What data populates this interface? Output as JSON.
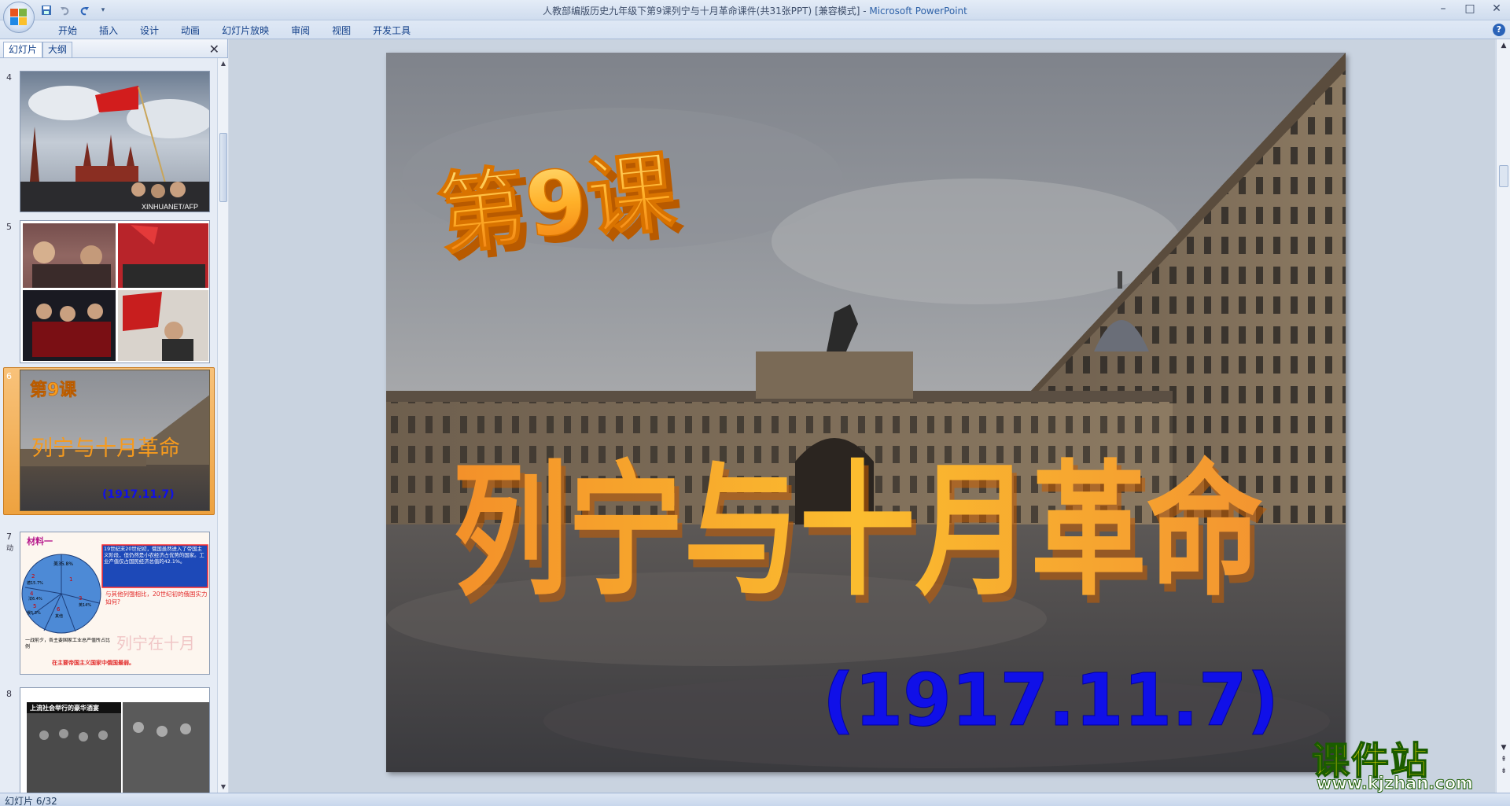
{
  "window": {
    "title_doc": "人教部编版历史九年级下第9课列宁与十月革命课件(共31张PPT) [兼容模式]",
    "title_sep": " - ",
    "title_app": "Microsoft PowerPoint",
    "minimize": "–",
    "maximize": "□",
    "close": "✕"
  },
  "qat": {
    "save": "save-icon",
    "undo": "undo-icon",
    "redo": "redo-icon",
    "more": "▾"
  },
  "ribbon": {
    "tabs": [
      "开始",
      "插入",
      "设计",
      "动画",
      "幻灯片放映",
      "审阅",
      "视图",
      "开发工具"
    ],
    "help": "?"
  },
  "left_pane": {
    "tabs": [
      "幻灯片",
      "大纲"
    ],
    "close": "✕",
    "thumbnails": [
      {
        "number": "4",
        "caption": "XINHUANET/AFP"
      },
      {
        "number": "5"
      },
      {
        "number": "6",
        "title": "第9课",
        "main": "列宁与十月革命",
        "date": "(1917.11.7)"
      },
      {
        "number": "7",
        "note_icon": "动",
        "heading": "材料一",
        "box_text": "19世纪末20世纪初，俄国虽然进入了帝国主义阶段，但仍然是小农经济占优势的国家。工业产值仅占国民经济总值的42.1%。",
        "question": "与其他列强相比，20世纪初的俄国实力如何?",
        "pie_top": "美35.8%",
        "pie_labels": [
          "1",
          "2",
          "3",
          "4",
          "5",
          "6"
        ],
        "pie_names": [
          "德15.7%",
          "英14%",
          "法6.4%",
          "俄5.3%",
          "其他"
        ],
        "legend": "一战前夕，各主要国家工业总产值所占比例",
        "footer": "在主要帝国主义国家中俄国最弱。",
        "overlay": "列宁在十月"
      },
      {
        "number": "8",
        "banner": "上流社会举行的豪华酒宴"
      }
    ]
  },
  "slide": {
    "title": "第9课",
    "main_title": "列宁与十月革命",
    "date": "(1917.11.7)"
  },
  "watermark": {
    "title": "课件站",
    "url": "www.kjzhan.com"
  },
  "status": {
    "text": "幻灯片 6/32"
  },
  "colors": {
    "orange": "#f59a1e",
    "blue": "#1010e8",
    "title_bar": "#dfe8f5"
  }
}
